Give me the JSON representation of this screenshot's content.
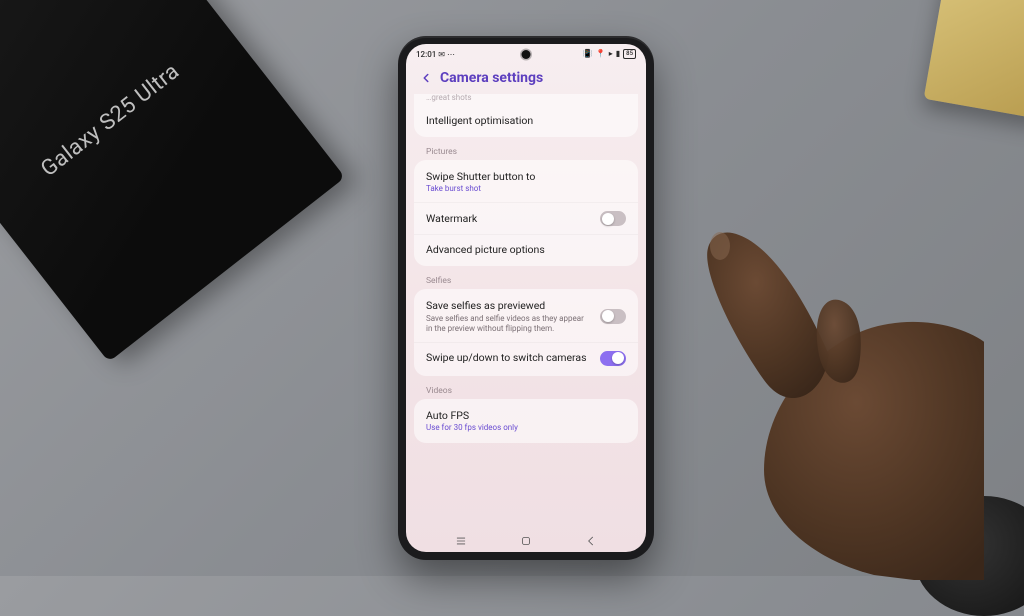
{
  "scene": {
    "box_label": "Galaxy S25 Ultra"
  },
  "statusbar": {
    "time": "12:01",
    "battery": "85"
  },
  "header": {
    "title": "Camera settings"
  },
  "top_card": {
    "truncated_hint": "…great shots",
    "intelligent_opt": "Intelligent optimisation"
  },
  "sections": {
    "pictures": {
      "label": "Pictures",
      "swipe_shutter": {
        "title": "Swipe Shutter button to",
        "value": "Take burst shot"
      },
      "watermark": {
        "title": "Watermark",
        "on": false
      },
      "advanced": {
        "title": "Advanced picture options"
      }
    },
    "selfies": {
      "label": "Selfies",
      "save_preview": {
        "title": "Save selfies as previewed",
        "desc": "Save selfies and selfie videos as they appear in the preview without flipping them.",
        "on": false
      },
      "swipe_switch": {
        "title": "Swipe up/down to switch cameras",
        "on": true
      }
    },
    "videos": {
      "label": "Videos",
      "auto_fps": {
        "title": "Auto FPS",
        "value": "Use for 30 fps videos only"
      }
    }
  }
}
